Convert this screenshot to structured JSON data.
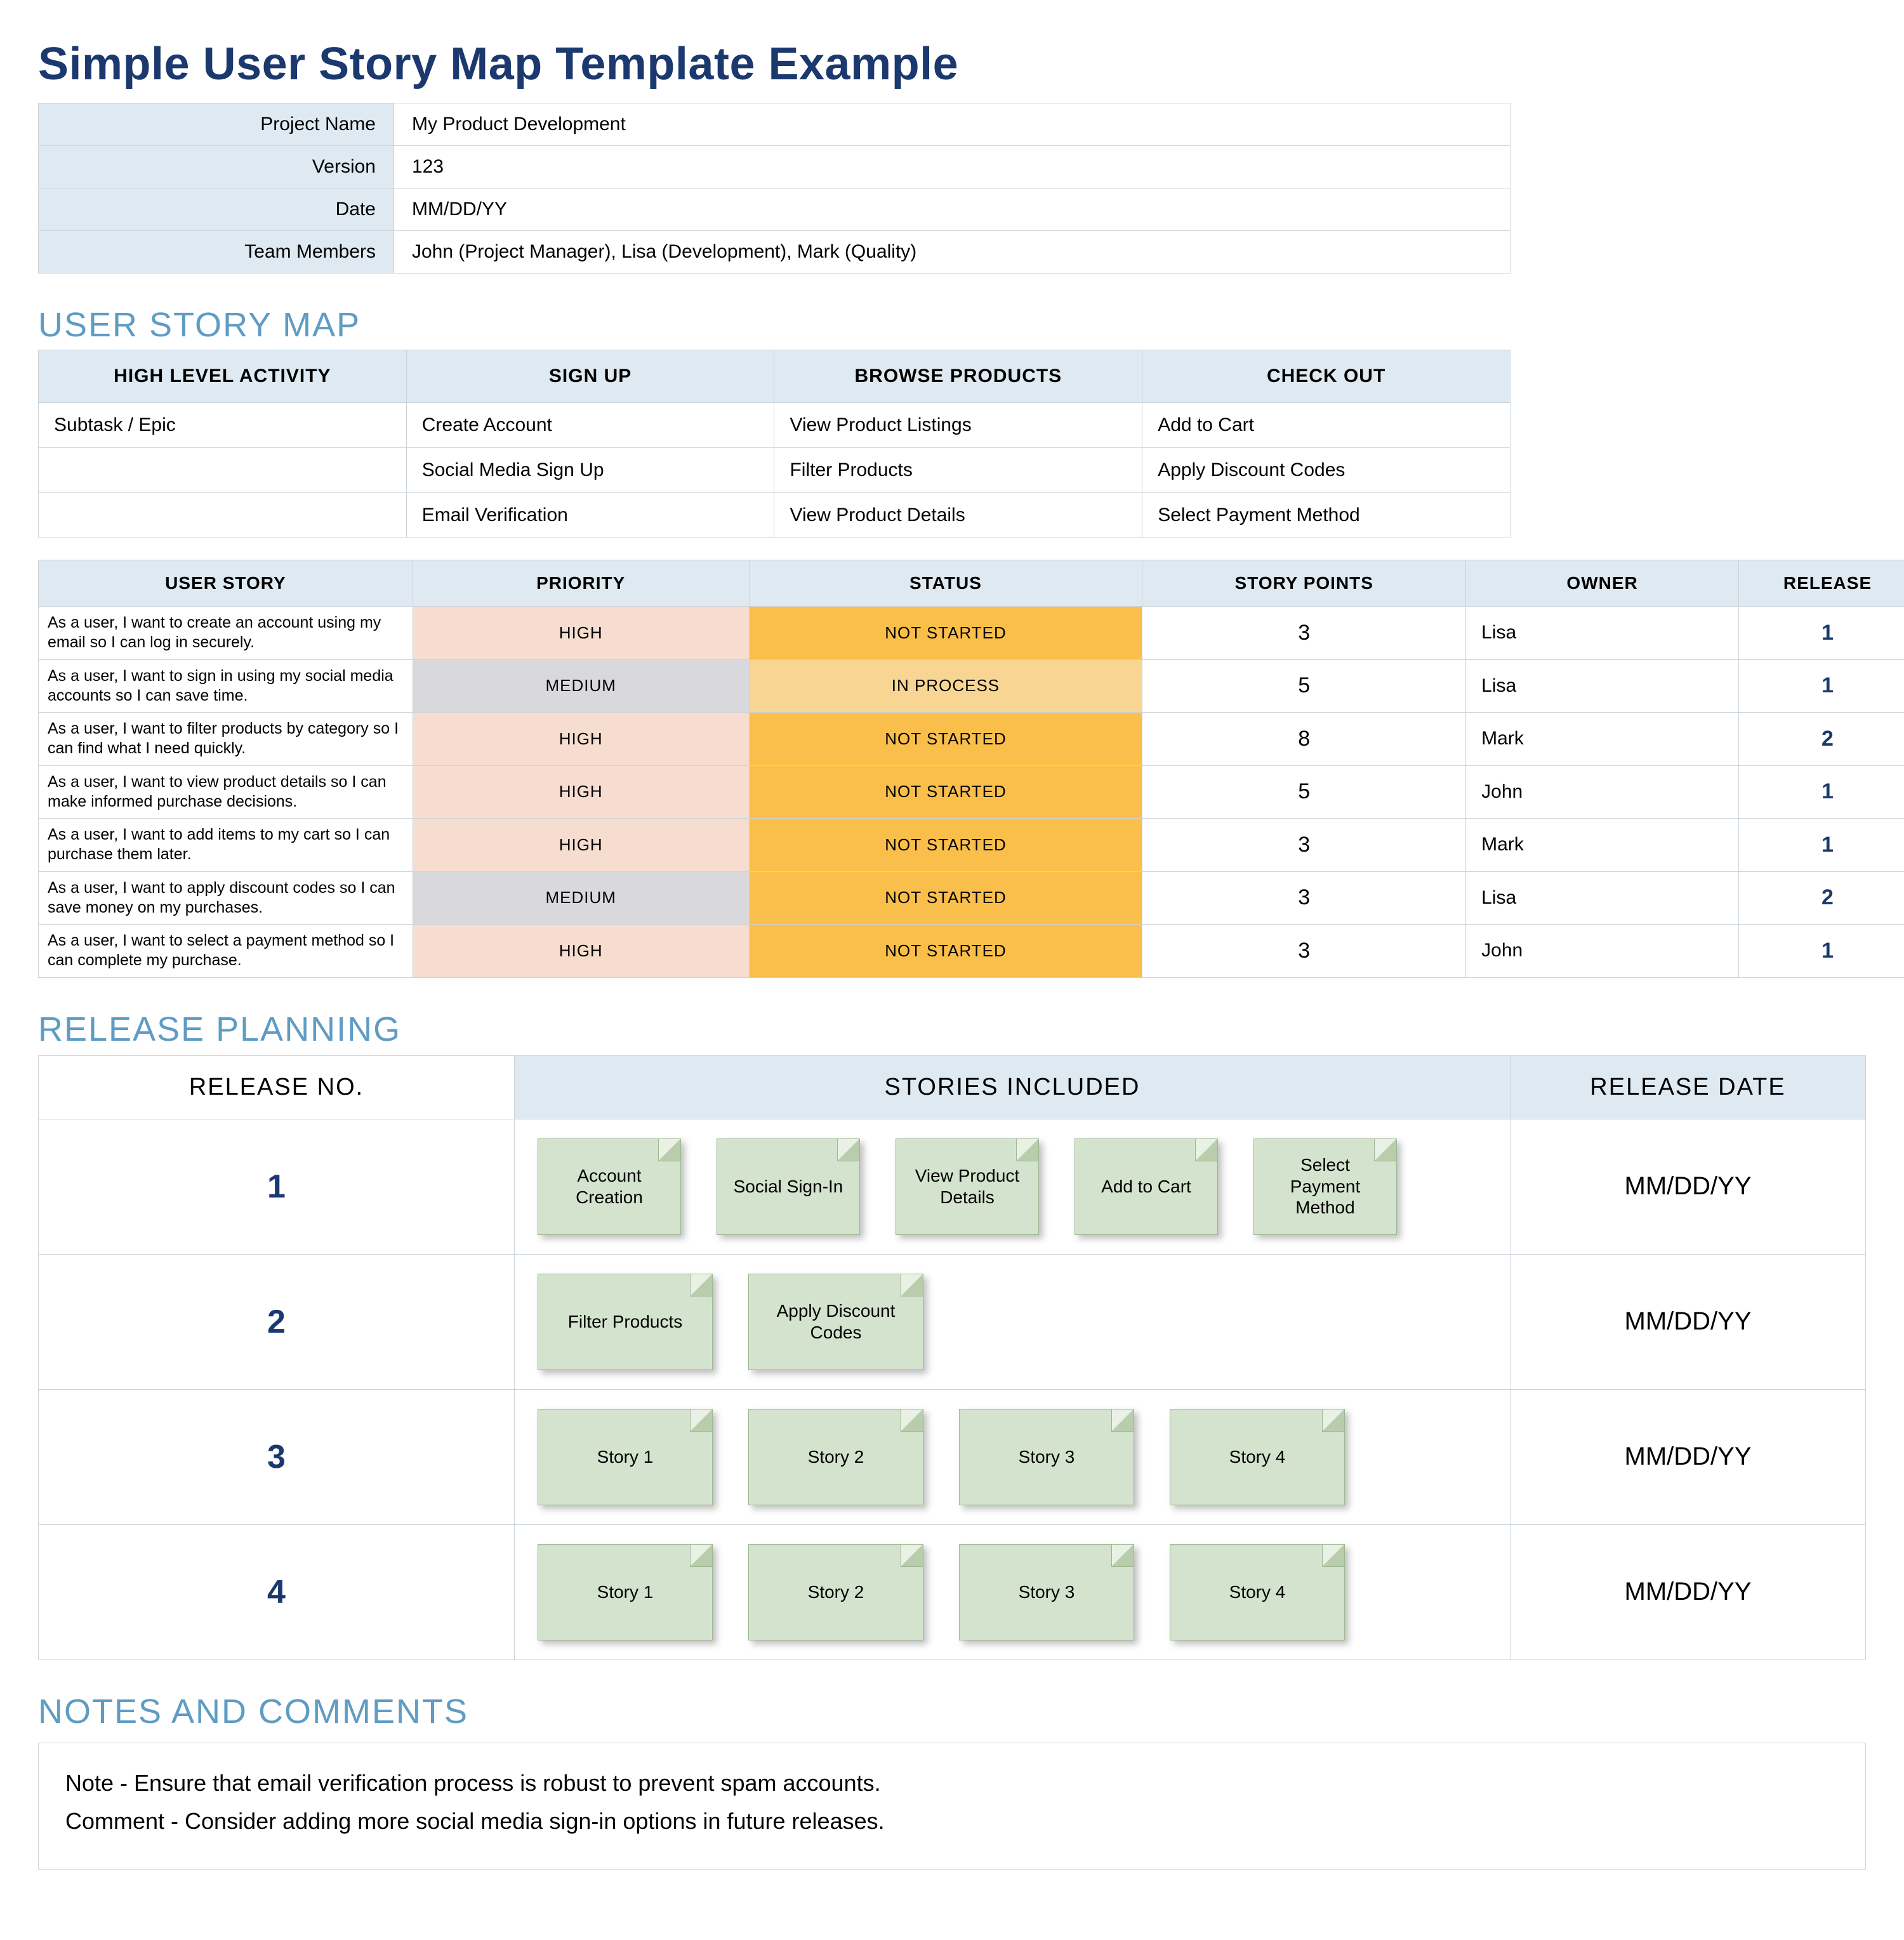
{
  "title": "Simple User Story Map Template Example",
  "meta": {
    "rows": [
      {
        "label": "Project Name",
        "value": "My Product Development"
      },
      {
        "label": "Version",
        "value": "123"
      },
      {
        "label": "Date",
        "value": "MM/DD/YY"
      },
      {
        "label": "Team Members",
        "value": "John (Project Manager), Lisa (Development), Mark (Quality)"
      }
    ]
  },
  "sections": {
    "map_title": "USER STORY MAP",
    "release_title": "RELEASE PLANNING",
    "notes_title": "NOTES AND COMMENTS"
  },
  "map": {
    "head": {
      "activity": "HIGH LEVEL ACTIVITY",
      "cols": [
        "SIGN UP",
        "BROWSE PRODUCTS",
        "CHECK OUT"
      ]
    },
    "row_label": "Subtask / Epic",
    "rows": [
      [
        "Create Account",
        "View Product Listings",
        "Add to Cart"
      ],
      [
        "Social Media Sign Up",
        "Filter Products",
        "Apply Discount Codes"
      ],
      [
        "Email Verification",
        "View Product Details",
        "Select Payment Method"
      ]
    ]
  },
  "stories": {
    "head": {
      "story": "USER STORY",
      "priority": "PRIORITY",
      "status": "STATUS",
      "points": "STORY POINTS",
      "owner": "OWNER",
      "release": "RELEASE"
    },
    "rows": [
      {
        "story": "As a user, I want to create an account using my email so I can log in securely.",
        "priority": "HIGH",
        "status": "NOT STARTED",
        "points": "3",
        "owner": "Lisa",
        "release": "1"
      },
      {
        "story": "As a user, I want to sign in using my social media accounts so I can save time.",
        "priority": "MEDIUM",
        "status": "IN PROCESS",
        "points": "5",
        "owner": "Lisa",
        "release": "1"
      },
      {
        "story": "As a user, I want to filter products by category so I can find what I need quickly.",
        "priority": "HIGH",
        "status": "NOT STARTED",
        "points": "8",
        "owner": "Mark",
        "release": "2"
      },
      {
        "story": "As a user, I want to view product details so I can make informed purchase decisions.",
        "priority": "HIGH",
        "status": "NOT STARTED",
        "points": "5",
        "owner": "John",
        "release": "1"
      },
      {
        "story": "As a user, I want to add items to my cart so I can purchase them later.",
        "priority": "HIGH",
        "status": "NOT STARTED",
        "points": "3",
        "owner": "Mark",
        "release": "1"
      },
      {
        "story": "As a user, I want to apply discount codes so I can save money on my purchases.",
        "priority": "MEDIUM",
        "status": "NOT STARTED",
        "points": "3",
        "owner": "Lisa",
        "release": "2"
      },
      {
        "story": "As a user, I want to select a payment method so I can complete my purchase.",
        "priority": "HIGH",
        "status": "NOT STARTED",
        "points": "3",
        "owner": "John",
        "release": "1"
      }
    ]
  },
  "releases": {
    "head": {
      "no": "RELEASE NO.",
      "stories": "STORIES INCLUDED",
      "date": "RELEASE DATE"
    },
    "rows": [
      {
        "no": "1",
        "date": "MM/DD/YY",
        "wide": false,
        "stories": [
          "Account Creation",
          "Social Sign-In",
          "View Product Details",
          "Add to Cart",
          "Select Payment Method"
        ]
      },
      {
        "no": "2",
        "date": "MM/DD/YY",
        "wide": true,
        "stories": [
          "Filter Products",
          "Apply Discount Codes"
        ]
      },
      {
        "no": "3",
        "date": "MM/DD/YY",
        "wide": true,
        "stories": [
          "Story 1",
          "Story 2",
          "Story 3",
          "Story 4"
        ]
      },
      {
        "no": "4",
        "date": "MM/DD/YY",
        "wide": true,
        "stories": [
          "Story 1",
          "Story 2",
          "Story 3",
          "Story 4"
        ]
      }
    ]
  },
  "notes": {
    "lines": [
      "Note - Ensure that email verification process is robust to prevent spam accounts.",
      "Comment - Consider adding more social media sign-in options in future releases."
    ]
  }
}
